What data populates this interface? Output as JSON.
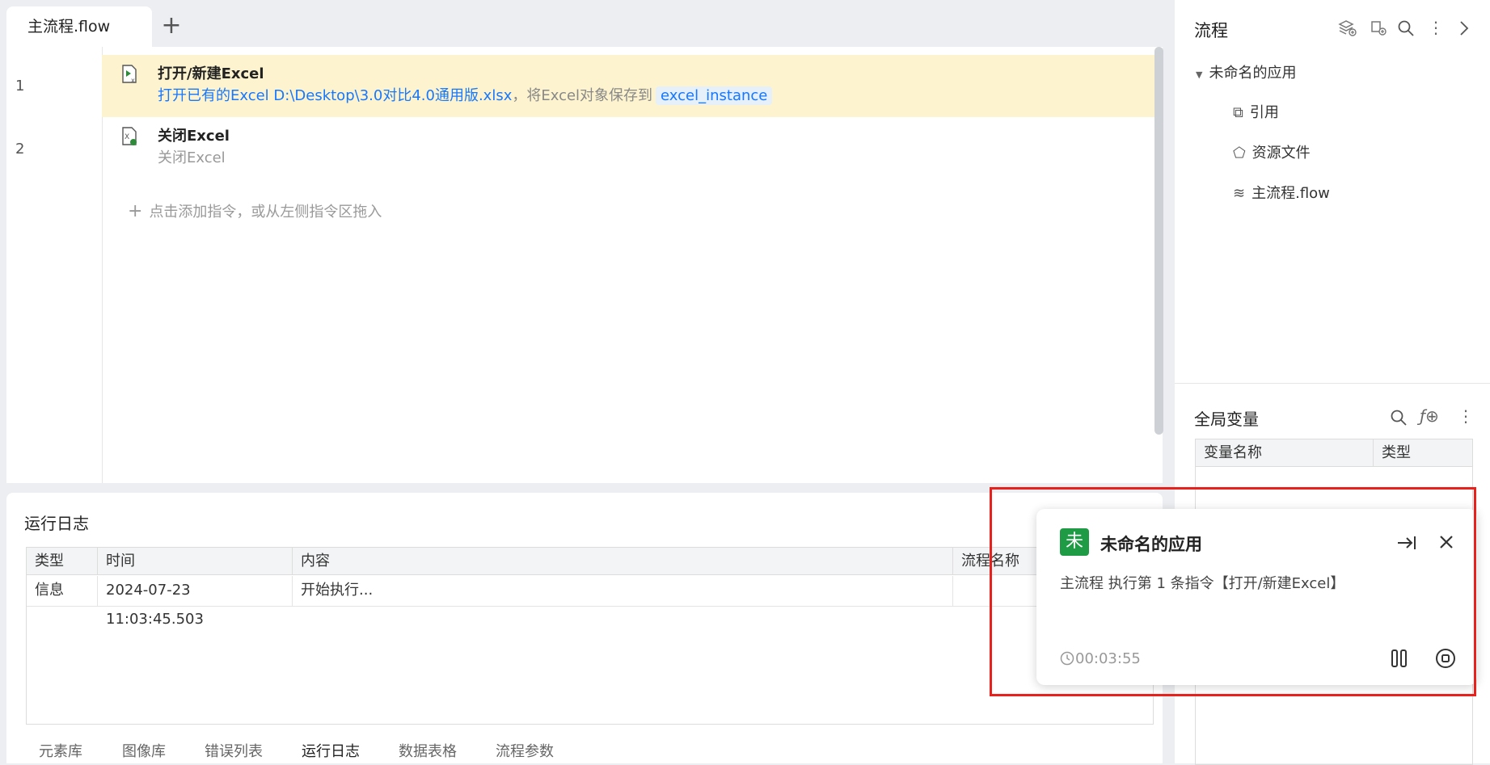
{
  "tabs": {
    "active": "主流程.flow",
    "add": "+"
  },
  "editor": {
    "lines": [
      "1",
      "2"
    ],
    "commands": [
      {
        "title": "打开/新建Excel",
        "desc_prefix": "打开已有的Excel D:\\Desktop\\3.0对比4.0通用版.xlsx",
        "desc_mid": "，将Excel对象保存到",
        "variable": "excel_instance"
      },
      {
        "title": "关闭Excel",
        "desc": "关闭Excel"
      }
    ],
    "add_hint": "点击添加指令，或从左侧指令区拖入"
  },
  "log": {
    "title": "运行日志",
    "columns": [
      "类型",
      "时间",
      "内容",
      "流程名称"
    ],
    "rows": [
      {
        "type": "信息",
        "time": "2024-07-23 11:03:45.503",
        "content": "开始执行...",
        "flow": ""
      }
    ]
  },
  "bottom_tabs": [
    "元素库",
    "图像库",
    "错误列表",
    "运行日志",
    "数据表格",
    "流程参数"
  ],
  "sidebar": {
    "flow_title": "流程",
    "app_name": "未命名的应用",
    "tree": [
      "引用",
      "资源文件",
      "主流程.flow"
    ],
    "globals_title": "全局变量",
    "var_columns": [
      "变量名称",
      "类型"
    ],
    "fx_label": "ƒ⊕"
  },
  "toast": {
    "badge": "未",
    "title": "未命名的应用",
    "message": "主流程 执行第 1 条指令【打开/新建Excel】",
    "elapsed": "00:03:55"
  },
  "colors": {
    "highlight": "#fdf4cf",
    "accent": "#1677ff",
    "badge": "#1f9b45",
    "annotation": "#e8211c"
  }
}
